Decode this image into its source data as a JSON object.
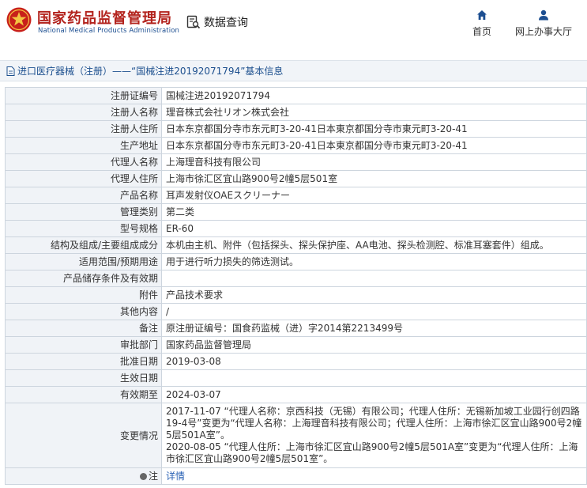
{
  "header": {
    "brand_cn": "国家药品监督管理局",
    "brand_en": "National Medical Products Administration",
    "query_label": "数据查询",
    "nav_home": "首页",
    "nav_hall": "网上办事大厅"
  },
  "breadcrumb": {
    "text": "进口医疗器械（注册）——“国械注进20192071794”基本信息"
  },
  "rows": [
    {
      "label": "注册证编号",
      "value": "国械注进20192071794"
    },
    {
      "label": "注册人名称",
      "value": "理音株式会社リオン株式会社"
    },
    {
      "label": "注册人住所",
      "value": "日本东京都国分寺市东元町3-20-41日本東京都国分寺市東元町3-20-41"
    },
    {
      "label": "生产地址",
      "value": "日本东京都国分寺市东元町3-20-41日本東京都国分寺市東元町3-20-41"
    },
    {
      "label": "代理人名称",
      "value": "上海理音科技有限公司"
    },
    {
      "label": "代理人住所",
      "value": "上海市徐汇区宜山路900号2幢5层501室"
    },
    {
      "label": "产品名称",
      "value": "耳声发射仪OAEスクリーナー"
    },
    {
      "label": "管理类别",
      "value": "第二类"
    },
    {
      "label": "型号规格",
      "value": "ER-60"
    },
    {
      "label": "结构及组成/主要组成成分",
      "value": "本机由主机、附件（包括探头、探头保护座、AA电池、探头检测腔、标准耳塞套件）组成。"
    },
    {
      "label": "适用范围/预期用途",
      "value": "用于进行听力损失的筛选测试。"
    },
    {
      "label": "产品储存条件及有效期",
      "value": ""
    },
    {
      "label": "附件",
      "value": "产品技术要求"
    },
    {
      "label": "其他内容",
      "value": "/"
    },
    {
      "label": "备注",
      "value": "原注册证编号：国食药监械（进）字2014第2213499号"
    },
    {
      "label": "审批部门",
      "value": "国家药品监督管理局"
    },
    {
      "label": "批准日期",
      "value": "2019-03-08"
    },
    {
      "label": "生效日期",
      "value": ""
    },
    {
      "label": "有效期至",
      "value": "2024-03-07"
    }
  ],
  "change": {
    "label": "变更情况",
    "line1": "2017-11-07 “代理人名称：京西科技（无锡）有限公司；代理人住所：无锡新加坡工业园行创四路19-4号”变更为“代理人名称：上海理音科技有限公司；代理人住所：上海市徐汇区宜山路900号2幢5层501A室”。",
    "line2": "2020-08-05 “代理人住所：上海市徐汇区宜山路900号2幢5层501A室”变更为“代理人住所：上海市徐汇区宜山路900号2幢5层501室”。"
  },
  "note": {
    "label": "注",
    "link": "详情"
  },
  "colors": {
    "brand_red": "#b3231d",
    "brand_blue": "#1d4f91",
    "nav_blue": "#1c4f8e",
    "key_bg": "#f0f3f7"
  }
}
